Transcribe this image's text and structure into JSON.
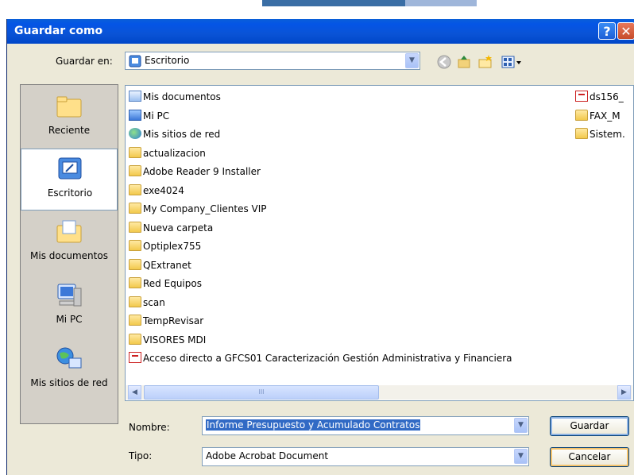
{
  "window": {
    "title": "Guardar como",
    "help_glyph": "?",
    "close_glyph": "✕"
  },
  "toolbar": {
    "location_label": "Guardar en:",
    "location_value": "Escritorio",
    "back_icon": "back-arrow-icon",
    "up_icon": "up-folder-icon",
    "new_folder_icon": "new-folder-icon",
    "view_menu_icon": "view-menu-icon"
  },
  "places": [
    {
      "label": "Reciente",
      "icon": "recent-folder-icon",
      "selected": false
    },
    {
      "label": "Escritorio",
      "icon": "desktop-icon",
      "selected": true
    },
    {
      "label": "Mis documentos",
      "icon": "my-documents-icon",
      "selected": false
    },
    {
      "label": "Mi PC",
      "icon": "my-computer-icon",
      "selected": false
    },
    {
      "label": "Mis sitios de red",
      "icon": "network-places-icon",
      "selected": false
    }
  ],
  "files_col1": [
    {
      "name": "Mis documentos",
      "type": "doc"
    },
    {
      "name": "Mi PC",
      "type": "pc"
    },
    {
      "name": "Mis sitios de red",
      "type": "net"
    },
    {
      "name": "actualizacion",
      "type": "folder"
    },
    {
      "name": "Adobe Reader 9 Installer",
      "type": "folder"
    },
    {
      "name": "exe4024",
      "type": "folder"
    },
    {
      "name": "My Company_Clientes VIP",
      "type": "folder"
    },
    {
      "name": "Nueva carpeta",
      "type": "folder"
    },
    {
      "name": "Optiplex755",
      "type": "folder"
    },
    {
      "name": "QExtranet",
      "type": "folder"
    },
    {
      "name": "Red Equipos",
      "type": "folder"
    },
    {
      "name": "scan",
      "type": "folder"
    },
    {
      "name": "TempRevisar",
      "type": "folder"
    },
    {
      "name": "VISORES MDI",
      "type": "folder"
    },
    {
      "name": "Acceso directo a GFCS01 Caracterización Gestión Administrativa y Financiera",
      "type": "pdf"
    }
  ],
  "files_col2": [
    {
      "name": "ds156_",
      "type": "pdf"
    },
    {
      "name": "FAX_M",
      "type": "folder"
    },
    {
      "name": "Sistem.",
      "type": "folder"
    }
  ],
  "scrollbar": {
    "left_arrow": "◀",
    "right_arrow": "▶",
    "grip": "III"
  },
  "form": {
    "name_label": "Nombre:",
    "name_value": "Informe Presupuesto y Acumulado Contratos",
    "type_label": "Tipo:",
    "type_value": "Adobe Acrobat Document"
  },
  "buttons": {
    "save": "Guardar",
    "cancel": "Cancelar"
  },
  "colors": {
    "titlebar": "#0455e6",
    "selection": "#316ac5",
    "dialog_bg": "#ece9d8"
  }
}
